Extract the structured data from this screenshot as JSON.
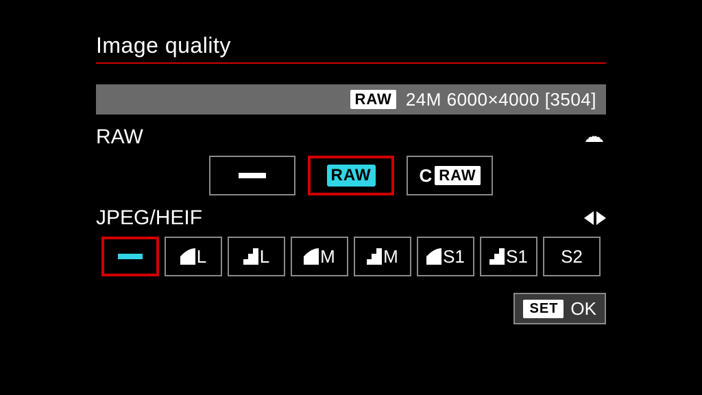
{
  "title": "Image quality",
  "status": {
    "raw_badge": "RAW",
    "resolution_text": "24M 6000×4000 [3504]"
  },
  "raw_section": {
    "label": "RAW",
    "options": {
      "none": "—",
      "raw": "RAW",
      "craw_prefix": "C",
      "craw_badge": "RAW"
    },
    "selected": "raw"
  },
  "jpeg_section": {
    "label": "JPEG/HEIF",
    "options": [
      {
        "id": "none",
        "label": "",
        "icon": "dash"
      },
      {
        "id": "fine-l",
        "label": "L",
        "icon": "fine"
      },
      {
        "id": "normal-l",
        "label": "L",
        "icon": "normal"
      },
      {
        "id": "fine-m",
        "label": "M",
        "icon": "fine"
      },
      {
        "id": "normal-m",
        "label": "M",
        "icon": "normal"
      },
      {
        "id": "fine-s1",
        "label": "S1",
        "icon": "fine"
      },
      {
        "id": "normal-s1",
        "label": "S1",
        "icon": "normal"
      },
      {
        "id": "s2",
        "label": "S2",
        "icon": ""
      }
    ],
    "selected": "none"
  },
  "footer": {
    "set_badge": "SET",
    "ok_label": "OK"
  }
}
